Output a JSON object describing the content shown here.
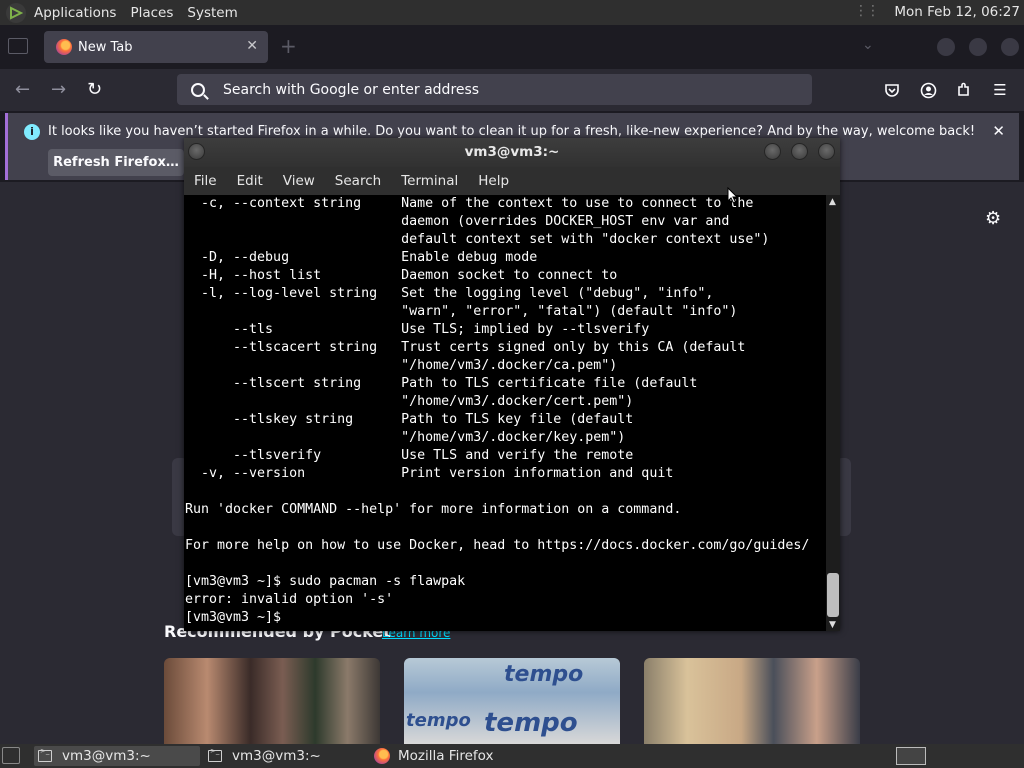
{
  "top_panel": {
    "menus": [
      "Applications",
      "Places",
      "System"
    ],
    "clock": "Mon Feb 12, 06:27"
  },
  "firefox": {
    "tab_title": "New Tab",
    "url_placeholder": "Search with Google or enter address",
    "notification": {
      "message": "It looks like you haven’t started Firefox in a while. Do you want to clean it up for a fresh, like-new experience? And by the way, welcome back!",
      "button": "Refresh Firefox…"
    },
    "pocket_heading": "Recommended by Pocket",
    "pocket_learn_more": "Learn more",
    "card2_logo": "tempo"
  },
  "terminal": {
    "title": "vm3@vm3:~",
    "menu": [
      "File",
      "Edit",
      "View",
      "Search",
      "Terminal",
      "Help"
    ],
    "lines": [
      "  -c, --context string     Name of the context to use to connect to the",
      "                           daemon (overrides DOCKER_HOST env var and",
      "                           default context set with \"docker context use\")",
      "  -D, --debug              Enable debug mode",
      "  -H, --host list          Daemon socket to connect to",
      "  -l, --log-level string   Set the logging level (\"debug\", \"info\",",
      "                           \"warn\", \"error\", \"fatal\") (default \"info\")",
      "      --tls                Use TLS; implied by --tlsverify",
      "      --tlscacert string   Trust certs signed only by this CA (default",
      "                           \"/home/vm3/.docker/ca.pem\")",
      "      --tlscert string     Path to TLS certificate file (default",
      "                           \"/home/vm3/.docker/cert.pem\")",
      "      --tlskey string      Path to TLS key file (default",
      "                           \"/home/vm3/.docker/key.pem\")",
      "      --tlsverify          Use TLS and verify the remote",
      "  -v, --version            Print version information and quit",
      "",
      "Run 'docker COMMAND --help' for more information on a command.",
      "",
      "For more help on how to use Docker, head to https://docs.docker.com/go/guides/",
      "",
      "[vm3@vm3 ~]$ sudo pacman -s flawpak",
      "error: invalid option '-s'",
      "[vm3@vm3 ~]$ "
    ]
  },
  "taskbar": {
    "tasks": [
      "vm3@vm3:~",
      "vm3@vm3:~",
      "Mozilla Firefox"
    ]
  }
}
